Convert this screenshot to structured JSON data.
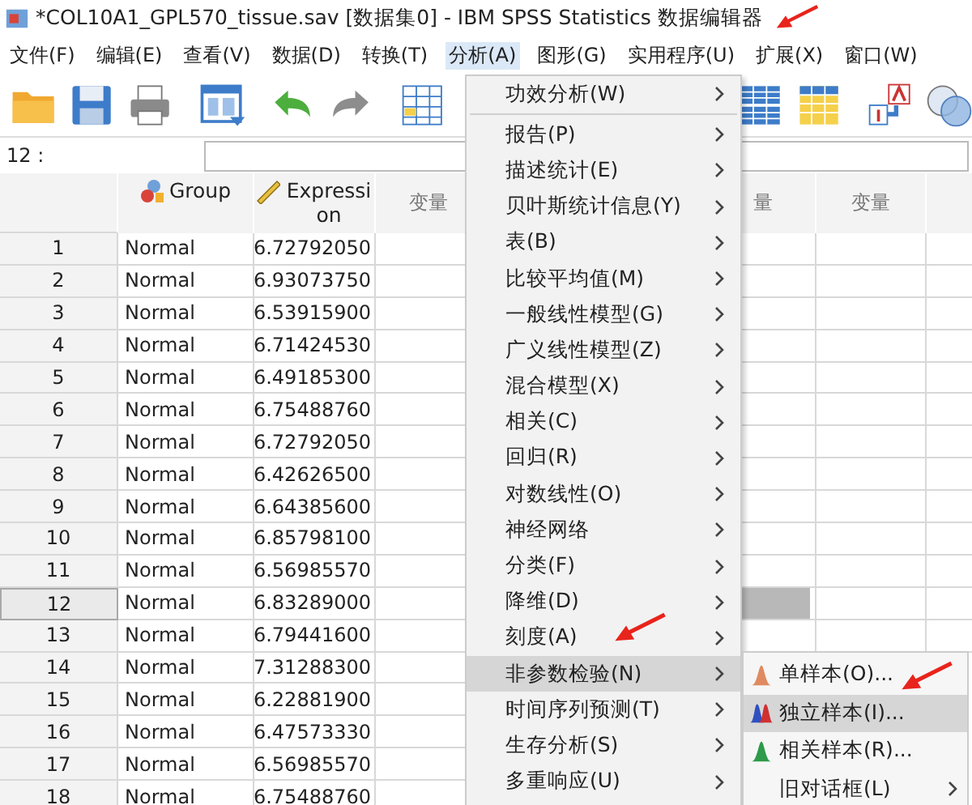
{
  "window": {
    "title": "*COL10A1_GPL570_tissue.sav [数据集0] - IBM SPSS Statistics 数据编辑器"
  },
  "menu_bar": [
    {
      "label": "文件(F)",
      "selected": false
    },
    {
      "label": "编辑(E)",
      "selected": false
    },
    {
      "label": "查看(V)",
      "selected": false
    },
    {
      "label": "数据(D)",
      "selected": false
    },
    {
      "label": "转换(T)",
      "selected": false
    },
    {
      "label": "分析(A)",
      "selected": true
    },
    {
      "label": "图形(G)",
      "selected": false
    },
    {
      "label": "实用程序(U)",
      "selected": false
    },
    {
      "label": "扩展(X)",
      "selected": false
    },
    {
      "label": "窗口(W)",
      "selected": false
    }
  ],
  "cell_editor": {
    "cell": "12 :"
  },
  "grid": {
    "columns": [
      {
        "label": "Group",
        "kind": "nominal"
      },
      {
        "label": "Expression",
        "kind": "scale"
      }
    ],
    "variable_headers": [
      "变量",
      "量",
      "变量"
    ],
    "rows": [
      {
        "num": "1",
        "group": "Normal",
        "expression": "6.72792050",
        "selected": false
      },
      {
        "num": "2",
        "group": "Normal",
        "expression": "6.93073750",
        "selected": false
      },
      {
        "num": "3",
        "group": "Normal",
        "expression": "6.53915900",
        "selected": false
      },
      {
        "num": "4",
        "group": "Normal",
        "expression": "6.71424530",
        "selected": false
      },
      {
        "num": "5",
        "group": "Normal",
        "expression": "6.49185300",
        "selected": false
      },
      {
        "num": "6",
        "group": "Normal",
        "expression": "6.75488760",
        "selected": false
      },
      {
        "num": "7",
        "group": "Normal",
        "expression": "6.72792050",
        "selected": false
      },
      {
        "num": "8",
        "group": "Normal",
        "expression": "6.42626500",
        "selected": false
      },
      {
        "num": "9",
        "group": "Normal",
        "expression": "6.64385600",
        "selected": false
      },
      {
        "num": "10",
        "group": "Normal",
        "expression": "6.85798100",
        "selected": false
      },
      {
        "num": "11",
        "group": "Normal",
        "expression": "6.56985570",
        "selected": false
      },
      {
        "num": "12",
        "group": "Normal",
        "expression": "6.83289000",
        "selected": true
      },
      {
        "num": "13",
        "group": "Normal",
        "expression": "6.79441600",
        "selected": false
      },
      {
        "num": "14",
        "group": "Normal",
        "expression": "7.31288300",
        "selected": false
      },
      {
        "num": "15",
        "group": "Normal",
        "expression": "6.22881900",
        "selected": false
      },
      {
        "num": "16",
        "group": "Normal",
        "expression": "6.47573330",
        "selected": false
      },
      {
        "num": "17",
        "group": "Normal",
        "expression": "6.56985570",
        "selected": false
      },
      {
        "num": "18",
        "group": "Normal",
        "expression": "6.75488760",
        "selected": false
      }
    ]
  },
  "analyze_menu": {
    "groups": [
      [
        {
          "label": "功效分析(W)",
          "selected": false
        }
      ],
      [
        {
          "label": "报告(P)",
          "selected": false
        },
        {
          "label": "描述统计(E)",
          "selected": false
        },
        {
          "label": "贝叶斯统计信息(Y)",
          "selected": false
        },
        {
          "label": "表(B)",
          "selected": false
        },
        {
          "label": "比较平均值(M)",
          "selected": false
        },
        {
          "label": "一般线性模型(G)",
          "selected": false
        },
        {
          "label": "广义线性模型(Z)",
          "selected": false
        },
        {
          "label": "混合模型(X)",
          "selected": false
        },
        {
          "label": "相关(C)",
          "selected": false
        },
        {
          "label": "回归(R)",
          "selected": false
        },
        {
          "label": "对数线性(O)",
          "selected": false
        },
        {
          "label": "神经网络",
          "selected": false
        },
        {
          "label": "分类(F)",
          "selected": false
        },
        {
          "label": "降维(D)",
          "selected": false
        },
        {
          "label": "刻度(A)",
          "selected": false
        },
        {
          "label": "非参数检验(N)",
          "selected": true
        },
        {
          "label": "时间序列预测(T)",
          "selected": false
        },
        {
          "label": "生存分析(S)",
          "selected": false
        },
        {
          "label": "多重响应(U)",
          "selected": false
        }
      ]
    ]
  },
  "nonparametric_submenu": [
    {
      "label": "单样本(O)...",
      "kind": "one-sample",
      "selected": false
    },
    {
      "label": "独立样本(I)...",
      "kind": "independent",
      "selected": true
    },
    {
      "label": "相关样本(R)...",
      "kind": "related",
      "selected": false
    },
    {
      "label": "旧对话框(L)",
      "kind": "submenu",
      "selected": false
    }
  ]
}
